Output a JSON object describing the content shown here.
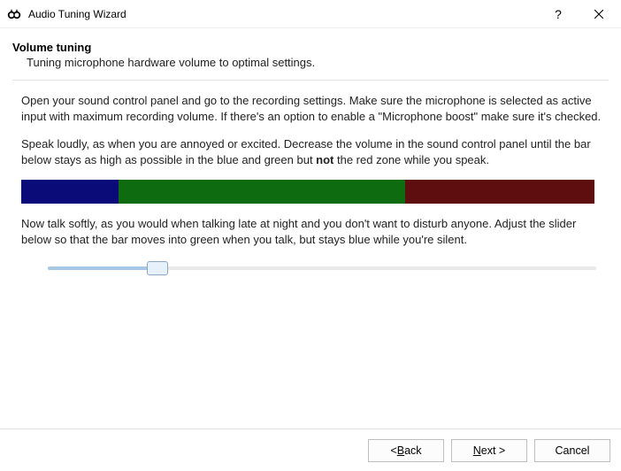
{
  "window": {
    "title": "Audio Tuning Wizard",
    "help_label": "?",
    "close_label": "Close"
  },
  "page": {
    "heading": "Volume tuning",
    "subheading": "Tuning microphone hardware volume to optimal settings.",
    "para1": "Open your sound control panel and go to the recording settings. Make sure the microphone is selected as active input with maximum recording volume. If there's an option to enable a \"Microphone boost\" make sure it's checked.",
    "para2_before": "Speak loudly, as when you are annoyed or excited. Decrease the volume in the sound control panel until the bar below stays as high as possible in the blue and green but ",
    "para2_bold": "not",
    "para2_after": " the red zone while you speak.",
    "para3": "Now talk softly, as you would when talking late at night and you don't want to disturb anyone. Adjust the slider below so that the bar moves into green when you talk, but stays blue while you're silent."
  },
  "meter": {
    "colors": {
      "blue": "#0a0a78",
      "green": "#0f6b0f",
      "red": "#5e0e0e"
    },
    "segments_pct": {
      "blue": 17,
      "green": 50,
      "red": 33
    }
  },
  "slider": {
    "value_pct": 20
  },
  "buttons": {
    "back_prefix": "< ",
    "back_mn": "B",
    "back_rest": "ack",
    "next_mn": "N",
    "next_rest": "ext >",
    "cancel": "Cancel"
  }
}
